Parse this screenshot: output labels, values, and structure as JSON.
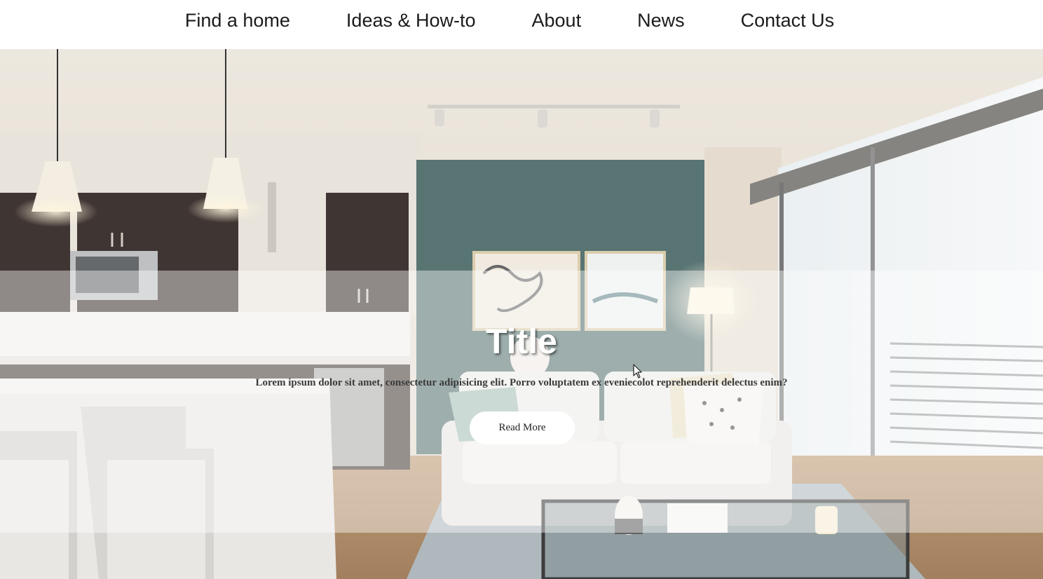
{
  "nav": {
    "items": [
      {
        "label": "Find a home"
      },
      {
        "label": "Ideas & How-to"
      },
      {
        "label": "About"
      },
      {
        "label": "News"
      },
      {
        "label": "Contact Us"
      }
    ]
  },
  "hero": {
    "title": "Title",
    "text": "Lorem ipsum dolor sit amet, consectetur adipisicing elit. Porro voluptatem ex eveniecolot reprehenderit delectus enim?",
    "button_label": "Read More"
  },
  "colors": {
    "nav_background": "#ffffff",
    "nav_text": "#1b1b1b",
    "accent_wall": "#4a6968",
    "cabinets": "#2f2421",
    "button_background": "#ffffff"
  },
  "icons": {
    "cursor": "mouse-pointer-icon"
  }
}
